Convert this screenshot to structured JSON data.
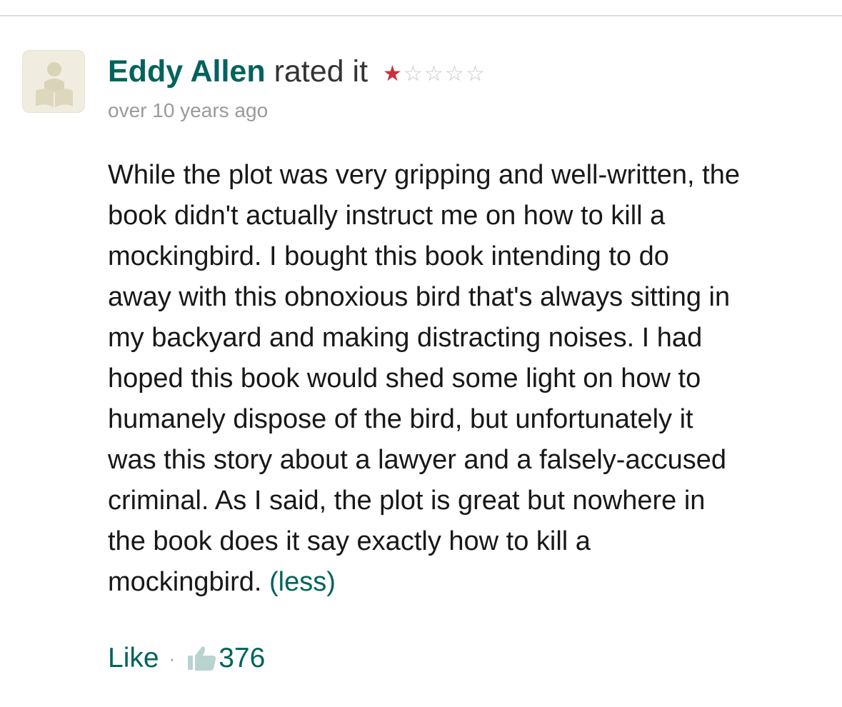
{
  "review": {
    "user_name": "Eddy Allen",
    "rated_text": "rated it",
    "rating": {
      "value": 1,
      "max": 5,
      "filled_color": "#c9303a",
      "empty_color": "#c8c8c8"
    },
    "timestamp": "over 10 years ago",
    "body_text": "While the plot was very gripping and well-written, the\nbook didn't actually instruct me on how to kill a\nmockingbird. I bought this book intending to do\naway with this obnoxious bird that's always sitting in\nmy backyard and making distracting noises. I had\nhoped this book would shed some light on how to\nhumanely dispose of the bird, but unfortunately it\nwas this story about a lawyer and a falsely-accused\ncriminal. As I said, the plot is great but nowhere in\nthe book does it say exactly how to kill a\nmockingbird. ",
    "less_label": "(less)"
  },
  "footer": {
    "like_label": "Like",
    "separator": "·",
    "like_icon": "thumbs-up-icon",
    "like_count": "376"
  },
  "colors": {
    "accent": "#00635d",
    "muted": "#9a9a9a",
    "avatar_bg": "#f0ede0"
  },
  "avatar": {
    "icon": "reader-placeholder-icon"
  }
}
